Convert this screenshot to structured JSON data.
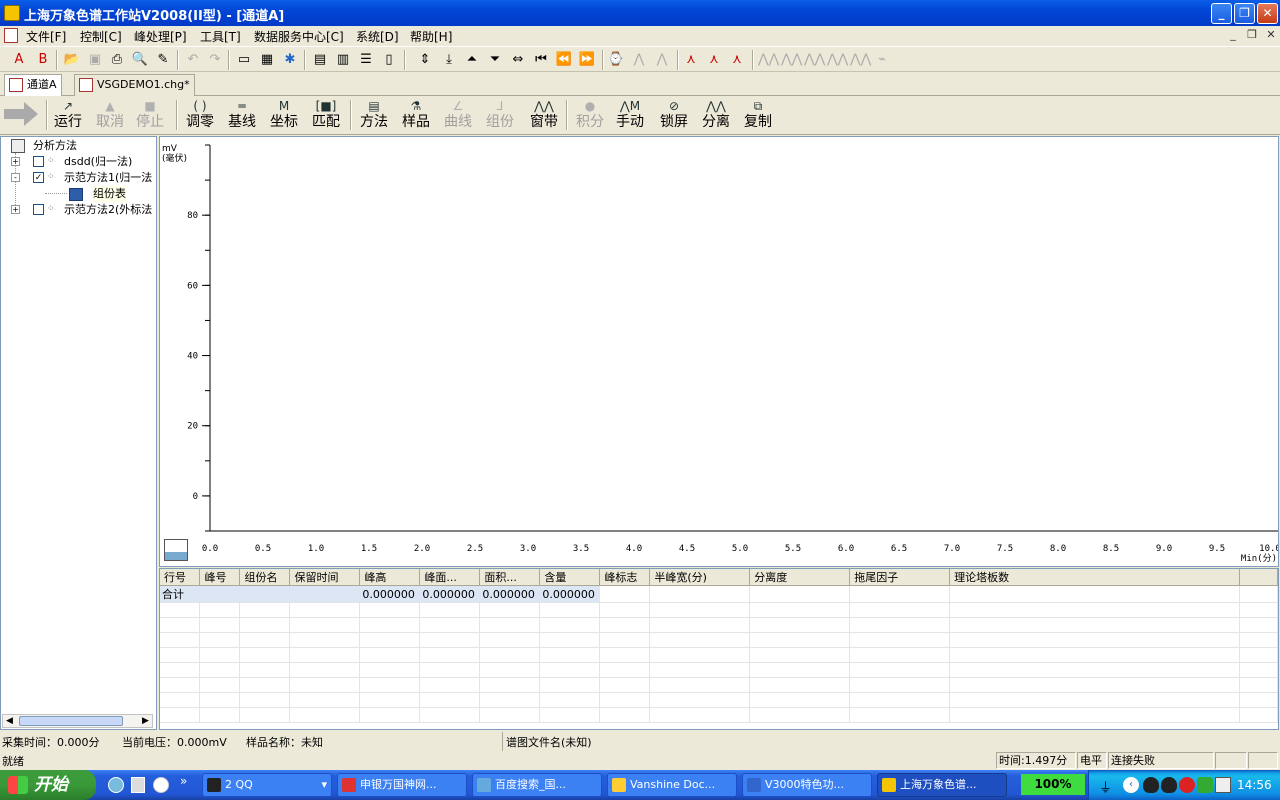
{
  "window": {
    "title": "上海万象色谱工作站V2008(II型) - [通道A]",
    "min": "_",
    "restore": "❐",
    "close": "✕"
  },
  "menu": {
    "items": [
      "文件[F]",
      "控制[C]",
      "峰处理[P]",
      "工具[T]",
      "数据服务中心[C]",
      "系统[D]",
      "帮助[H]"
    ]
  },
  "tabs": [
    {
      "label": "通道A",
      "active": true
    },
    {
      "label": "VSGDEMO1.chg*",
      "active": false
    }
  ],
  "toolbar2": {
    "buttons": [
      {
        "label": "运行",
        "icon": "run-icon",
        "glyph": "↗",
        "enabled": true
      },
      {
        "label": "取消",
        "icon": "cancel-icon",
        "glyph": "▲",
        "enabled": false
      },
      {
        "label": "停止",
        "icon": "stop-icon",
        "glyph": "■",
        "enabled": false
      },
      {
        "label": "调零",
        "icon": "zero-icon",
        "glyph": "( )",
        "enabled": true
      },
      {
        "label": "基线",
        "icon": "baseline-icon",
        "glyph": "═",
        "enabled": true
      },
      {
        "label": "坐标",
        "icon": "axis-icon",
        "glyph": "M",
        "enabled": true
      },
      {
        "label": "匹配",
        "icon": "match-icon",
        "glyph": "[■]",
        "enabled": true
      },
      {
        "label": "方法",
        "icon": "method-icon",
        "glyph": "▤",
        "enabled": true
      },
      {
        "label": "样品",
        "icon": "sample-icon",
        "glyph": "⚗",
        "enabled": true
      },
      {
        "label": "曲线",
        "icon": "curve-icon",
        "glyph": "∠",
        "enabled": false
      },
      {
        "label": "组份",
        "icon": "component-icon",
        "glyph": "⅃",
        "enabled": false
      },
      {
        "label": "窗带",
        "icon": "window-band-icon",
        "glyph": "⋀⋀",
        "enabled": true
      },
      {
        "label": "积分",
        "icon": "integrate-icon",
        "glyph": "●",
        "enabled": false
      },
      {
        "label": "手动",
        "icon": "manual-icon",
        "glyph": "⋀M",
        "enabled": true
      },
      {
        "label": "锁屏",
        "icon": "lock-screen-icon",
        "glyph": "⊘",
        "enabled": true
      },
      {
        "label": "分离",
        "icon": "separate-icon",
        "glyph": "⋀⋀",
        "enabled": true
      },
      {
        "label": "复制",
        "icon": "copy-icon",
        "glyph": "⧉",
        "enabled": true
      }
    ]
  },
  "tree": {
    "root": "分析方法",
    "nodes": [
      {
        "label": "dsdd(归一法)",
        "expander": "+",
        "checked": false
      },
      {
        "label": "示范方法1(归一法",
        "expander": "-",
        "checked": true
      },
      {
        "label": "组份表",
        "child": true
      },
      {
        "label": "示范方法2(外标法",
        "expander": "+",
        "checked": false
      }
    ]
  },
  "chart_data": {
    "type": "line",
    "ylabel": "mV\n(毫伏)",
    "xlabel": "Min(分)",
    "y_ticks": [
      0,
      20,
      40,
      60,
      80
    ],
    "x_ticks": [
      "0.0",
      "0.5",
      "1.0",
      "1.5",
      "2.0",
      "2.5",
      "3.0",
      "3.5",
      "4.0",
      "4.5",
      "5.0",
      "5.5",
      "6.0",
      "6.5",
      "7.0",
      "7.5",
      "8.0",
      "8.5",
      "9.0",
      "9.5",
      "10.0"
    ],
    "xlim": [
      0,
      10
    ],
    "ylim": [
      -10,
      100
    ],
    "series": []
  },
  "grid": {
    "columns": [
      "行号",
      "峰号",
      "组份名",
      "保留时间",
      "峰高",
      "峰面...",
      "面积...",
      "含量",
      "峰标志",
      "半峰宽(分)",
      "分离度",
      "拖尾因子",
      "理论塔板数"
    ],
    "rows": [
      [
        "合计",
        "",
        "",
        "",
        "0.000000",
        "0.000000",
        "0.000000",
        "0.000000",
        "",
        "",
        "",
        "",
        ""
      ]
    ],
    "empty_rows": 8
  },
  "status": {
    "acq_time": "采集时间：0.000分",
    "voltage": "当前电压：0.000mV",
    "sample_name": "样品名称：未知",
    "chrom_file": "谱图文件名(未知)",
    "ready": "就绪",
    "time": "时间:1.497分",
    "level": "电平",
    "connection": "连接失败"
  },
  "taskbar": {
    "start": "开始",
    "tasks": [
      {
        "label": "2 QQ",
        "icon": "qq-icon",
        "active": false
      },
      {
        "label": "申银万国神网...",
        "icon": "browser-icon",
        "active": false
      },
      {
        "label": "百度搜索_国...",
        "icon": "ie-icon",
        "active": false
      },
      {
        "label": "Vanshine Doc...",
        "icon": "folder-icon",
        "active": false
      },
      {
        "label": "V3000特色功...",
        "icon": "word-icon",
        "active": false
      },
      {
        "label": "上海万象色谱...",
        "icon": "app-icon",
        "active": true
      }
    ],
    "zoom": "100%",
    "clock": "14:56"
  }
}
